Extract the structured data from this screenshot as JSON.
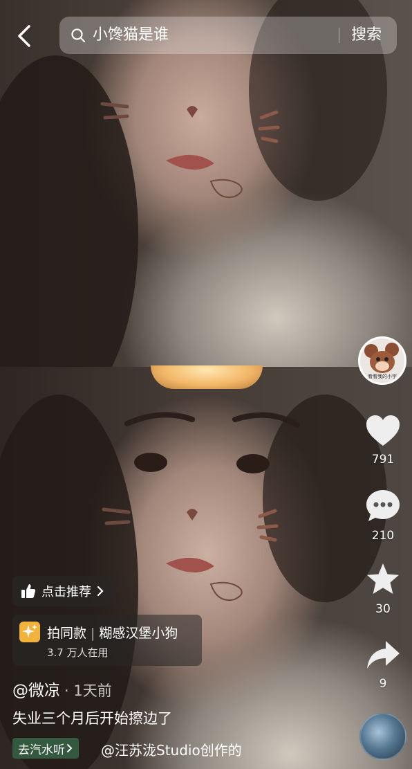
{
  "search": {
    "query": "小馋猫是谁",
    "button": "搜索"
  },
  "rail": {
    "avatar_caption": "看看我的小宇",
    "likes": "791",
    "comments": "210",
    "favorites": "30",
    "shares": "9"
  },
  "overlay": {
    "recommend_label": "点击推荐",
    "same_style": {
      "title": "拍同款",
      "effect_name": "糊感汉堡小狗",
      "users": "3.7 万人在用"
    },
    "author": "@微凉",
    "time": "· 1天前",
    "caption": "失业三个月后开始擦边了",
    "qishui_label": "去汽水听",
    "music_credit": "@汪苏泷Studio创作的"
  },
  "colors": {
    "accent_green": "#34593f",
    "badge_gold": "#f2b33d",
    "overlay_bg": "rgba(40,40,40,0.55)"
  }
}
